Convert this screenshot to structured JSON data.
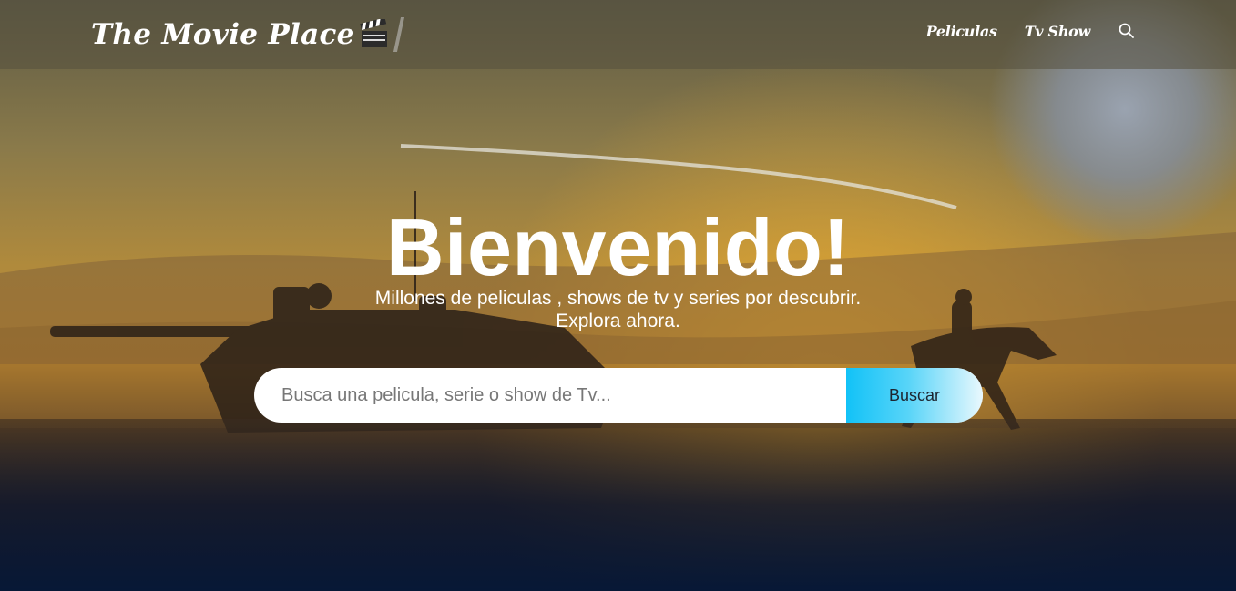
{
  "navbar": {
    "brand": "The Movie Place",
    "links": [
      {
        "label": "Peliculas"
      },
      {
        "label": "Tv Show"
      }
    ],
    "search_icon": "search-icon"
  },
  "hero": {
    "title": "Bienvenido!",
    "subtitle_line1": "Millones de peliculas , shows de tv y series por descubrir.",
    "subtitle_line2": "Explora ahora."
  },
  "search": {
    "placeholder": "Busca una pelicula, serie o show de Tv...",
    "value": "",
    "button_label": "Buscar"
  },
  "colors": {
    "button_gradient_start": "#12c2f7",
    "button_gradient_end": "#e9f8fd",
    "bottom_navy": "#071836"
  }
}
